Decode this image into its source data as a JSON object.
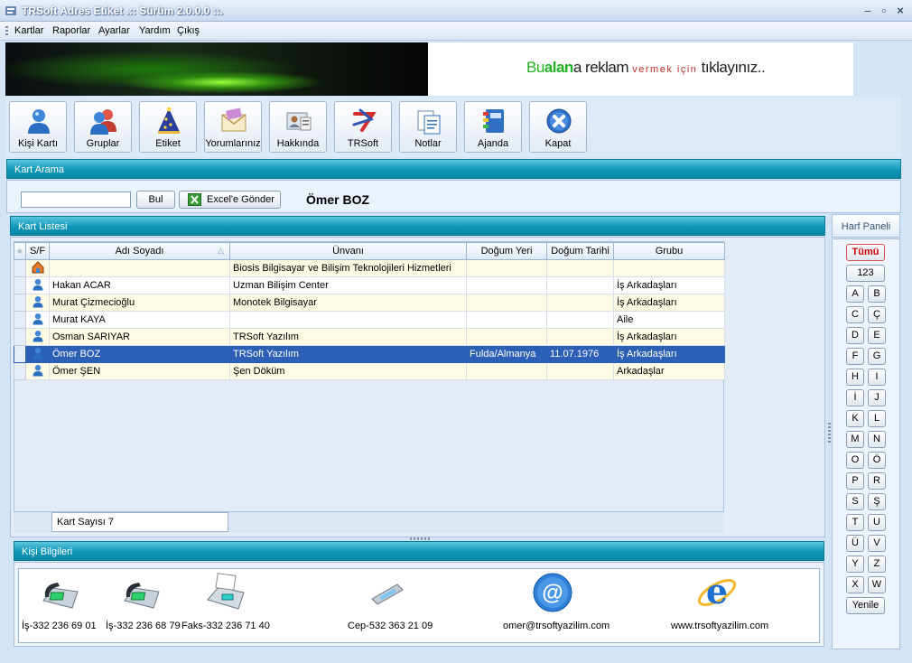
{
  "window": {
    "title": "TRSoft Adres Etiket  .:: Sürüm 2.0.0.0 ::."
  },
  "menu": [
    "Kartlar",
    "Raporlar",
    "Ayarlar",
    "Yardım",
    "Çıkış"
  ],
  "banner": {
    "ad_part1": "Bu",
    "ad_part2": "alan",
    "ad_part3": "a",
    "ad_part4": "reklam",
    "ad_part5": "vermek için",
    "ad_part6": "tıklayınız.."
  },
  "toolbar": [
    {
      "label": "Kişi Kartı",
      "icon": "person-card-icon"
    },
    {
      "label": "Gruplar",
      "icon": "groups-icon"
    },
    {
      "label": "Etiket",
      "icon": "label-icon"
    },
    {
      "label": "Yorumlarınız",
      "icon": "envelope-icon"
    },
    {
      "label": "Hakkında",
      "icon": "about-icon"
    },
    {
      "label": "TRSoft",
      "icon": "trsoft-logo-icon"
    },
    {
      "label": "Notlar",
      "icon": "notes-icon"
    },
    {
      "label": "Ajanda",
      "icon": "agenda-icon"
    },
    {
      "label": "Kapat",
      "icon": "close-icon"
    }
  ],
  "search": {
    "header": "Kart Arama",
    "value": "",
    "find_label": "Bul",
    "excel_label": "Excel'e Gönder",
    "selected_name": "Ömer BOZ"
  },
  "list": {
    "header": "Kart Listesi",
    "columns": [
      "S/F",
      "Adı Soyadı",
      "Ünvanı",
      "Doğum Yeri",
      "Doğum Tarihi",
      "Grubu"
    ],
    "rows": [
      {
        "type": "company",
        "name": "",
        "title": "Biosis Bilgisayar ve Bilişim Teknolojileri Hizmetleri",
        "birthplace": "",
        "birthdate": "",
        "group": ""
      },
      {
        "type": "person",
        "name": "Hakan ACAR",
        "title": "Uzman Bilişim Center",
        "birthplace": "",
        "birthdate": "",
        "group": "İş Arkadaşları"
      },
      {
        "type": "person",
        "name": "Murat Çizmecioğlu",
        "title": "Monotek Bilgisayar",
        "birthplace": "",
        "birthdate": "",
        "group": "İş Arkadaşları"
      },
      {
        "type": "person",
        "name": "Murat KAYA",
        "title": "",
        "birthplace": "",
        "birthdate": "",
        "group": "Aile"
      },
      {
        "type": "person",
        "name": "Osman SARIYAR",
        "title": "TRSoft Yazılım",
        "birthplace": "",
        "birthdate": "",
        "group": "İş Arkadaşları"
      },
      {
        "type": "person",
        "name": "Ömer BOZ",
        "title": "TRSoft Yazılım",
        "birthplace": "Fulda/Almanya",
        "birthdate": "11.07.1976",
        "group": "İş Arkadaşları",
        "selected": true
      },
      {
        "type": "person",
        "name": "Ömer ŞEN",
        "title": "Şen Döküm",
        "birthplace": "",
        "birthdate": "",
        "group": "Arkadaşlar"
      }
    ],
    "count_label": "Kart Sayısı 7"
  },
  "harf_panel": {
    "title": "Harf Paneli",
    "all_label": "Tümü",
    "num_label": "123",
    "letters": [
      "A",
      "B",
      "C",
      "Ç",
      "D",
      "E",
      "F",
      "G",
      "H",
      "I",
      "İ",
      "J",
      "K",
      "L",
      "M",
      "N",
      "O",
      "Ö",
      "P",
      "R",
      "S",
      "Ş",
      "T",
      "U",
      "Ü",
      "V",
      "Y",
      "Z",
      "X",
      "W"
    ],
    "refresh_label": "Yenile",
    "all_color": "#cc0000"
  },
  "contact": {
    "header": "Kişi Bilgileri",
    "phone1": "İş-332 236 69 01",
    "phone2": "İş-332 236 68 79",
    "fax": "Faks-332 236 71 40",
    "mobile": "Cep-532 363 21 09",
    "email": "omer@trsoftyazilim.com",
    "web": "www.trsoftyazilim.com"
  },
  "colors": {
    "header_teal": "#0e97b8",
    "selection": "#2c5fb6"
  }
}
